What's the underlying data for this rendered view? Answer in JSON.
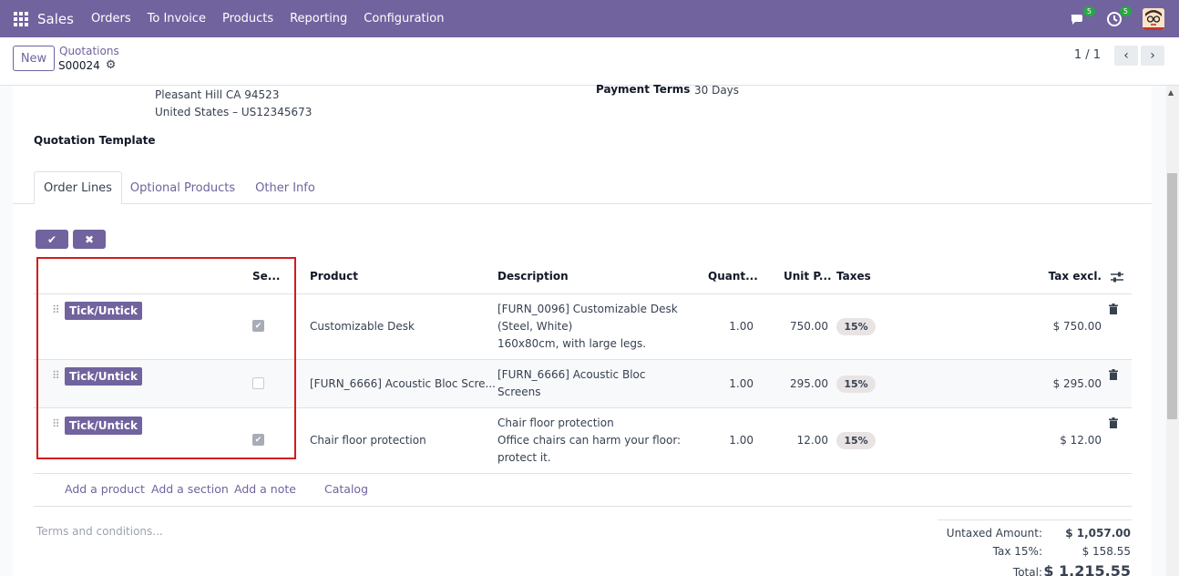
{
  "navbar": {
    "brand": "Sales",
    "menu": [
      "Orders",
      "To Invoice",
      "Products",
      "Reporting",
      "Configuration"
    ],
    "chat_count": "5",
    "activity_count": "5"
  },
  "control_panel": {
    "new_label": "New",
    "breadcrumb": "Quotations",
    "record_name": "S00024",
    "pager": "1 / 1"
  },
  "form": {
    "address_line1": "Pleasant Hill CA 94523",
    "address_line2": "United States – US12345673",
    "payment_terms_label": "Payment Terms",
    "payment_terms_value": "30 Days",
    "quotation_template_label": "Quotation Template"
  },
  "tabs": [
    "Order Lines",
    "Optional Products",
    "Other Info"
  ],
  "table": {
    "headers": {
      "select": "Se...",
      "product": "Product",
      "description": "Description",
      "quantity": "Quant...",
      "unit_price": "Unit P...",
      "taxes": "Taxes",
      "tax_excl": "Tax excl."
    },
    "rows": [
      {
        "tag": "Tick/Untick",
        "checked": true,
        "product": "Customizable Desk",
        "description": [
          "[FURN_0096] Customizable Desk",
          "(Steel, White)",
          "160x80cm, with large legs."
        ],
        "quantity": "1.00",
        "unit_price": "750.00",
        "tax": "15%",
        "subtotal": "$ 750.00"
      },
      {
        "tag": "Tick/Untick",
        "checked": false,
        "product": "[FURN_6666] Acoustic Bloc Scre...",
        "description": [
          "[FURN_6666] Acoustic Bloc",
          "Screens"
        ],
        "quantity": "1.00",
        "unit_price": "295.00",
        "tax": "15%",
        "subtotal": "$ 295.00"
      },
      {
        "tag": "Tick/Untick",
        "checked": true,
        "product": "Chair floor protection",
        "description": [
          "Chair floor protection",
          "Office chairs can harm your floor:",
          "protect it."
        ],
        "quantity": "1.00",
        "unit_price": "12.00",
        "tax": "15%",
        "subtotal": "$ 12.00"
      }
    ],
    "add_links": [
      "Add a product",
      "Add a section",
      "Add a note",
      "Catalog"
    ]
  },
  "footer": {
    "terms_placeholder": "Terms and conditions...",
    "untaxed_label": "Untaxed Amount:",
    "untaxed_value": "$ 1,057.00",
    "tax_label": "Tax 15%:",
    "tax_value": "$ 158.55",
    "total_label": "Total:",
    "total_value": "$ 1,215.55"
  },
  "colors": {
    "brand": "#71639e",
    "highlight_border": "#d7191c"
  }
}
